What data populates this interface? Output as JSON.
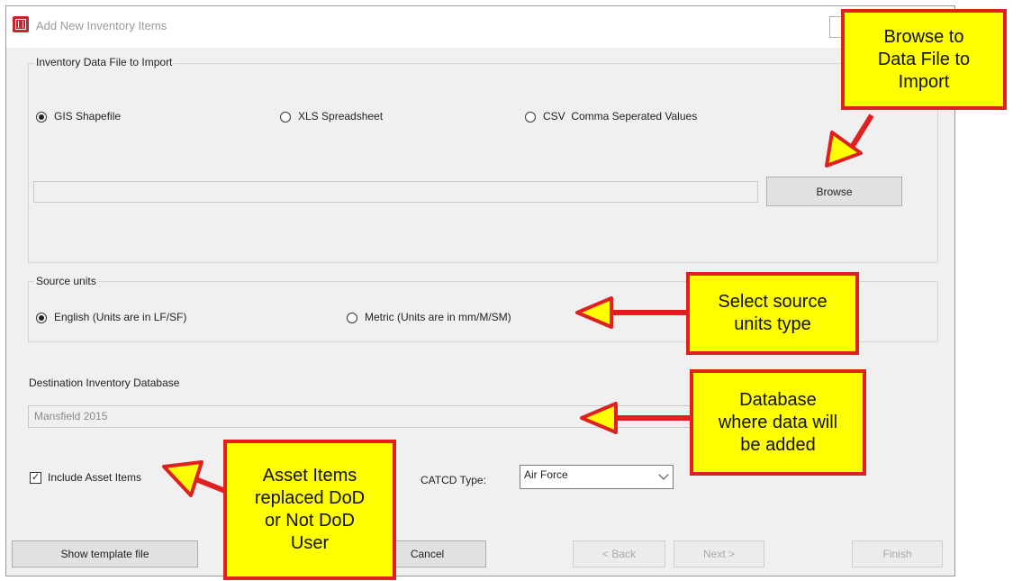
{
  "window": {
    "title": "Add New Inventory Items"
  },
  "import_group": {
    "legend": "Inventory Data File to Import",
    "options": [
      {
        "label": "GIS Shapefile",
        "selected": true
      },
      {
        "label": "XLS Spreadsheet",
        "selected": false
      },
      {
        "label": "CSV  Comma Seperated Values",
        "selected": false
      }
    ],
    "file_path": "",
    "browse_label": "Browse"
  },
  "units_group": {
    "legend": "Source units",
    "options": [
      {
        "label": "English (Units are in LF/SF)",
        "selected": true
      },
      {
        "label": "Metric (Units are in mm/M/SM)",
        "selected": false
      }
    ]
  },
  "destination": {
    "label": "Destination Inventory Database",
    "value": "Mansfield 2015"
  },
  "include_assets": {
    "label": "Include Asset Items",
    "checked": true
  },
  "catcd": {
    "label": "CATCD Type:",
    "value": "Air Force"
  },
  "footer": {
    "show_template": "Show template file",
    "cancel": "Cancel",
    "back": "< Back",
    "next": "Next >",
    "finish": "Finish"
  },
  "callouts": {
    "browse": "Browse to\nData File to\nImport",
    "units": "Select source\nunits type",
    "database": "Database\nwhere data will\nbe added",
    "asset": "Asset Items\nreplaced DoD\nor Not DoD\nUser"
  },
  "colors": {
    "callout_fill": "#ffff00",
    "callout_border": "#e02020",
    "window_bg": "#f0f0f0"
  }
}
